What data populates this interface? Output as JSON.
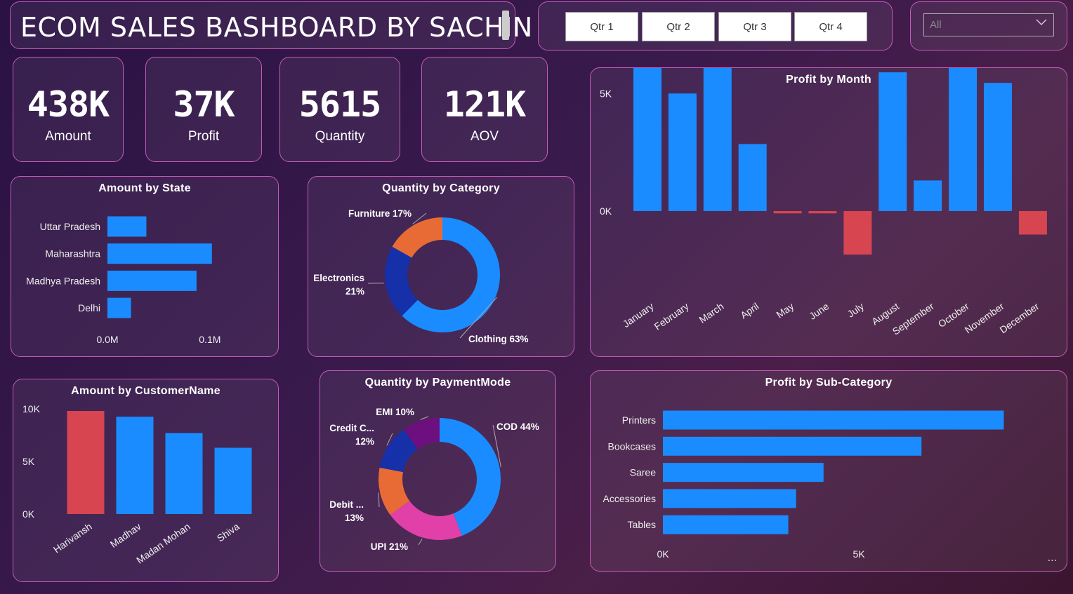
{
  "header": {
    "title": "ECOM SALES BASHBOARD BY SACHIN"
  },
  "quarters": [
    "Qtr 1",
    "Qtr 2",
    "Qtr 3",
    "Qtr 4"
  ],
  "slicer": {
    "value": "All"
  },
  "kpis": [
    {
      "value": "438K",
      "label": "Amount"
    },
    {
      "value": "37K",
      "label": "Profit"
    },
    {
      "value": "5615",
      "label": "Quantity"
    },
    {
      "value": "121K",
      "label": "AOV"
    }
  ],
  "colors": {
    "blue": "#1a8cff",
    "red": "#d64550",
    "border": "#c45ab9"
  },
  "chart_data": [
    {
      "id": "state",
      "type": "bar",
      "orientation": "horizontal",
      "title": "Amount by State",
      "categories": [
        "Uttar Pradesh",
        "Maharashtra",
        "Madhya Pradesh",
        "Delhi"
      ],
      "values": [
        0.038,
        0.102,
        0.087,
        0.023
      ],
      "xlim": [
        0,
        0.12
      ],
      "xticks": [
        0,
        0.1
      ],
      "xtick_labels": [
        "0.0M",
        "0.1M"
      ]
    },
    {
      "id": "category",
      "type": "pie",
      "title": "Quantity by Category",
      "categories": [
        "Clothing",
        "Electronics",
        "Furniture"
      ],
      "values": [
        63,
        21,
        17
      ],
      "labels": [
        [
          "Clothing 63%"
        ],
        [
          "Electronics",
          "21%"
        ],
        [
          "Furniture 17%"
        ]
      ],
      "colors": [
        "#1a8cff",
        "#1530a8",
        "#e86b35"
      ]
    },
    {
      "id": "month",
      "type": "bar",
      "title": "Profit by Month",
      "categories": [
        "January",
        "February",
        "March",
        "April",
        "May",
        "June",
        "July",
        "August",
        "September",
        "October",
        "November",
        "December"
      ],
      "values": [
        6100,
        5000,
        6150,
        2850,
        -100,
        -100,
        -1850,
        5900,
        1300,
        6300,
        5450,
        -1000
      ],
      "ylim": [
        -2000,
        6500
      ],
      "yticks": [
        0,
        5000
      ],
      "ytick_labels": [
        "0K",
        "5K"
      ],
      "colors_by_sign": {
        "positive": "#1a8cff",
        "negative": "#d64550"
      }
    },
    {
      "id": "customer",
      "type": "bar",
      "title": "Amount by CustomerName",
      "categories": [
        "Harivansh",
        "Madhav",
        "Madan Mohan",
        "Shiva"
      ],
      "values": [
        9800,
        9250,
        7700,
        6300
      ],
      "ylim": [
        0,
        10000
      ],
      "yticks": [
        0,
        5000,
        10000
      ],
      "ytick_labels": [
        "0K",
        "5K",
        "10K"
      ],
      "colors": [
        "#d64550",
        "#1a8cff",
        "#1a8cff",
        "#1a8cff"
      ]
    },
    {
      "id": "payment",
      "type": "pie",
      "title": "Quantity by PaymentMode",
      "categories": [
        "COD",
        "UPI",
        "Debit Card",
        "Credit Card",
        "EMI"
      ],
      "values": [
        44,
        21,
        13,
        12,
        10
      ],
      "labels": [
        [
          "COD 44%"
        ],
        [
          "UPI 21%"
        ],
        [
          "Debit ...",
          "13%"
        ],
        [
          "Credit C...",
          "12%"
        ],
        [
          "EMI 10%"
        ]
      ],
      "colors": [
        "#1a8cff",
        "#e040a8",
        "#e86b35",
        "#1530a8",
        "#6e0f80"
      ]
    },
    {
      "id": "subcat",
      "type": "bar",
      "orientation": "horizontal",
      "title": "Profit by Sub-Category",
      "categories": [
        "Printers",
        "Bookcases",
        "Saree",
        "Accessories",
        "Tables"
      ],
      "values": [
        8700,
        6600,
        4100,
        3400,
        3200
      ],
      "xlim": [
        0,
        10000
      ],
      "xticks": [
        0,
        5000
      ],
      "xtick_labels": [
        "0K",
        "5K"
      ],
      "more_label": "..."
    }
  ]
}
